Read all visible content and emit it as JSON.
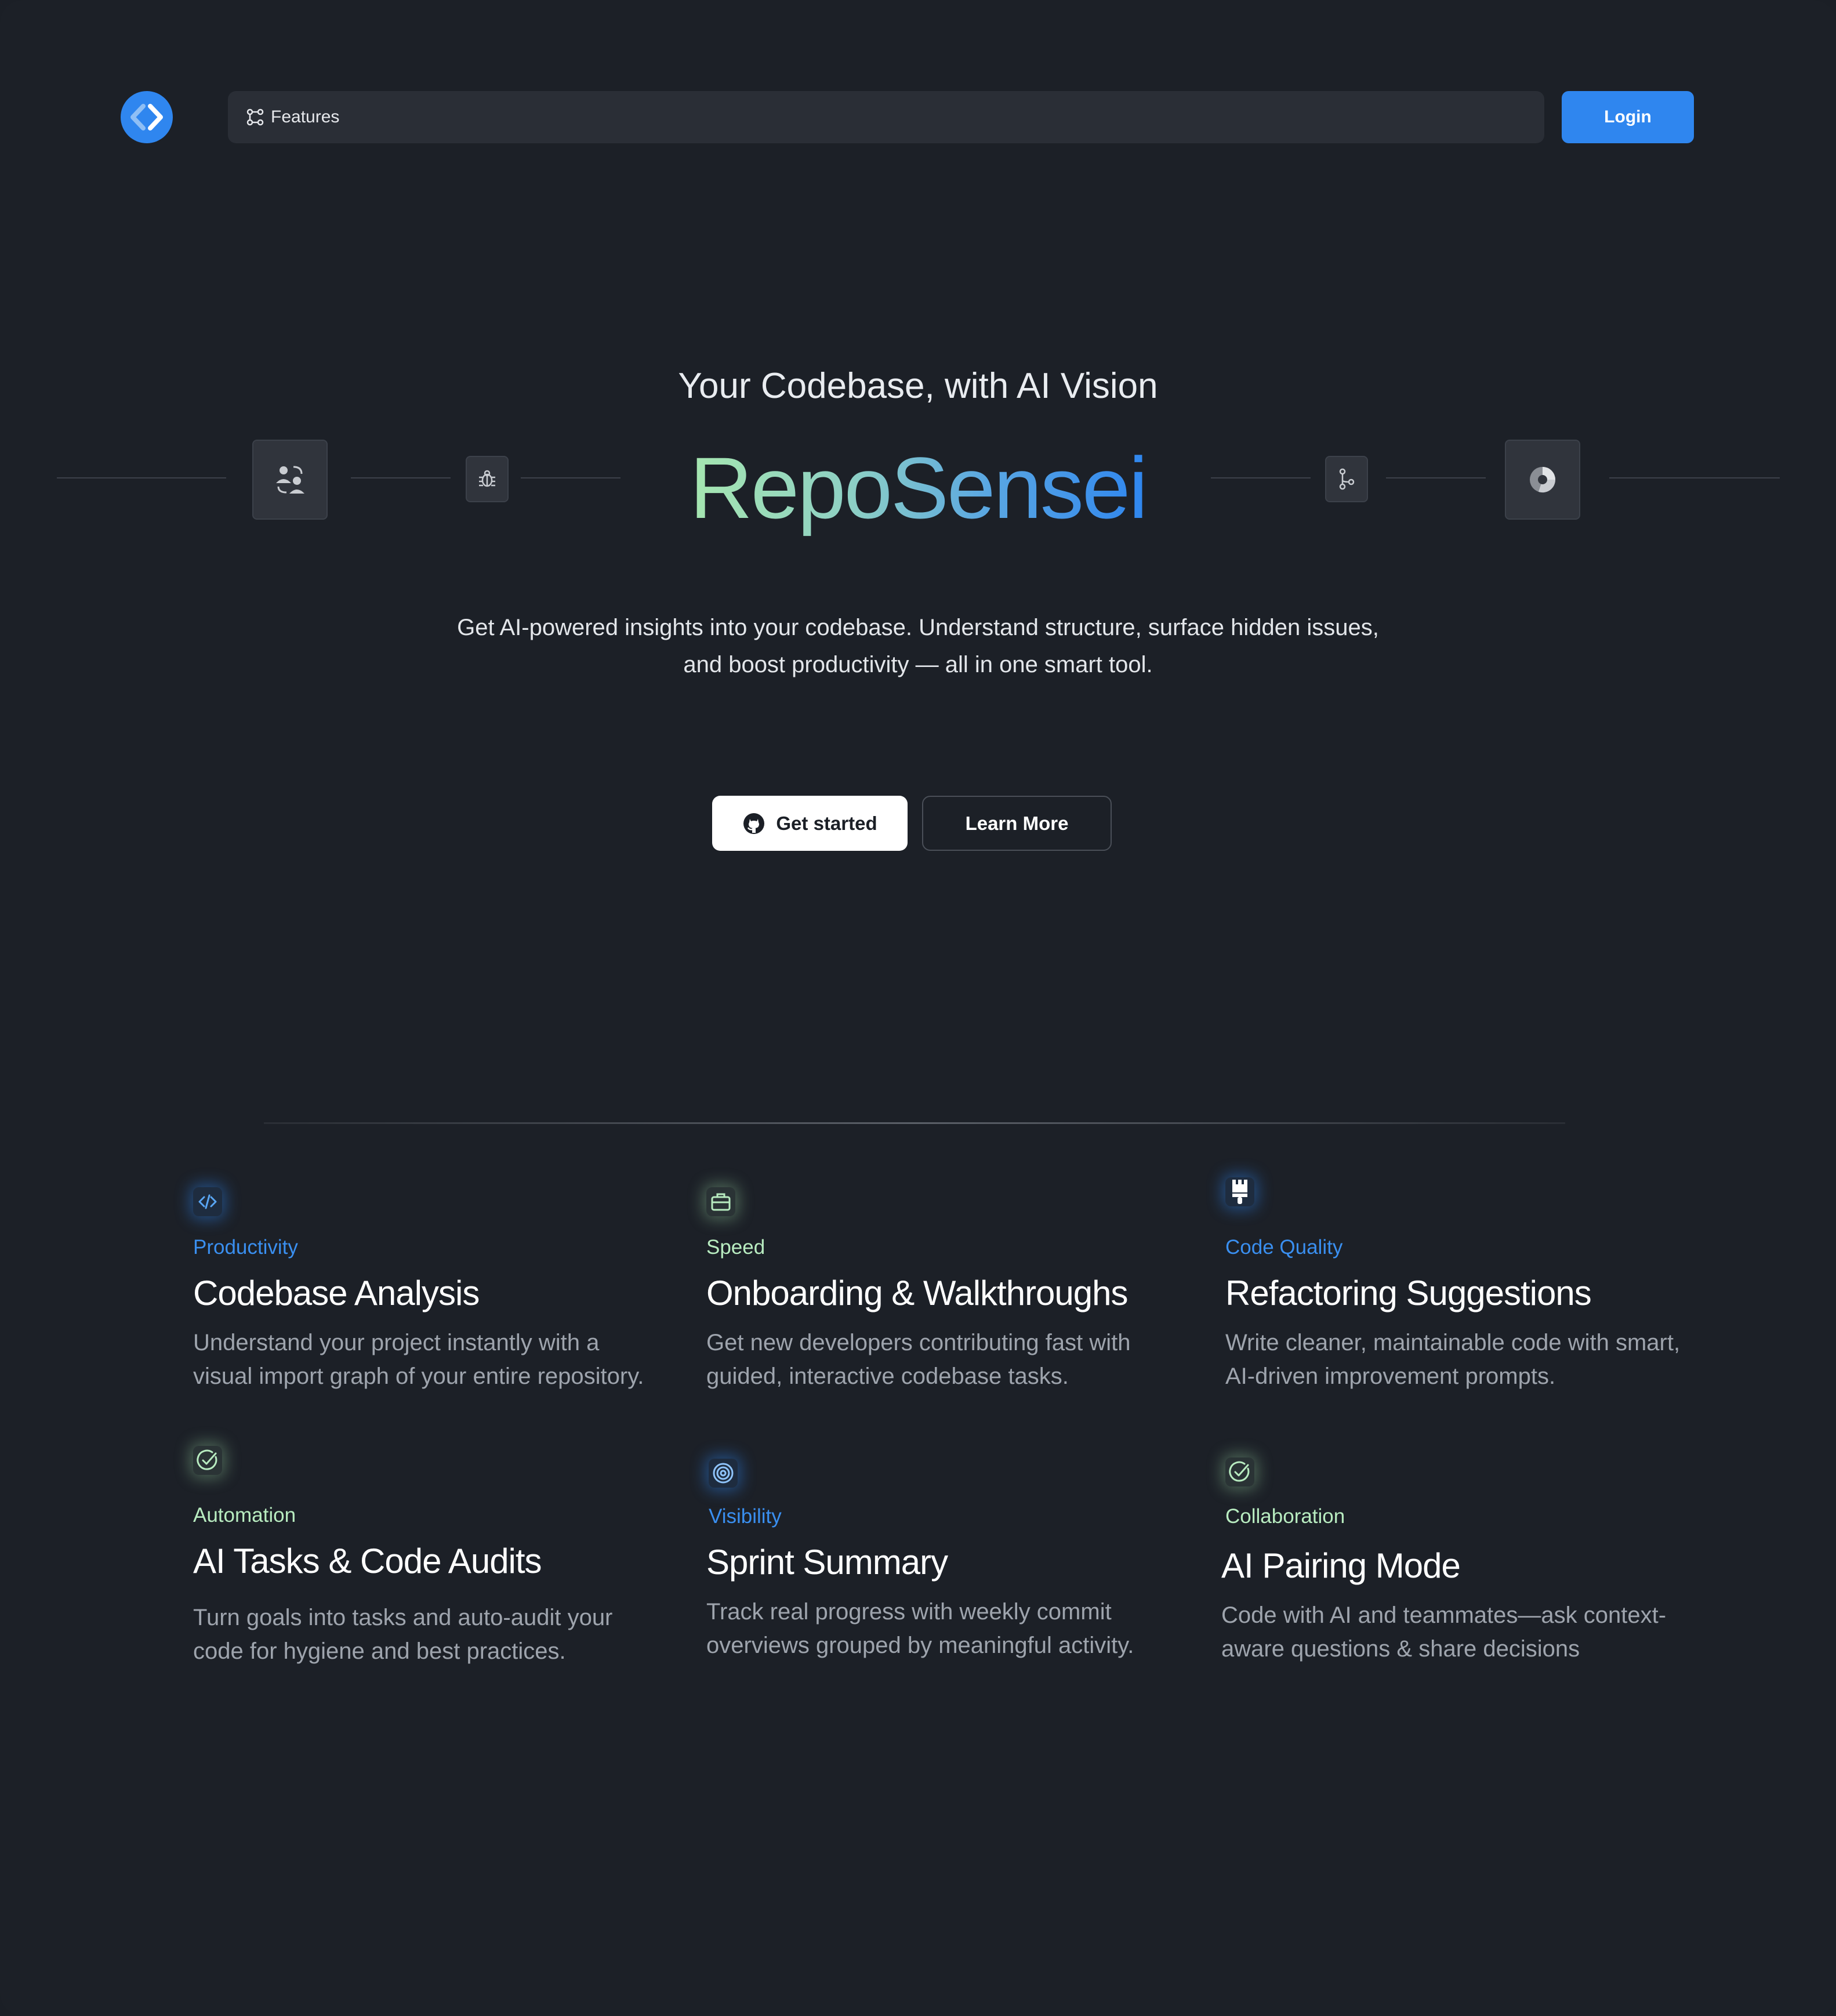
{
  "nav": {
    "items": [
      {
        "label": "Features",
        "icon": "graph-nodes-icon"
      }
    ],
    "login_label": "Login",
    "logo_icon": "code-chevron-logo-icon"
  },
  "hero": {
    "tagline": "Your Codebase, with AI Vision",
    "brand": "RepoSensei",
    "description": "Get AI-powered insights into your codebase. Understand structure, surface hidden issues, and boost productivity — all in one smart tool.",
    "cta_primary": "Get started",
    "cta_primary_icon": "github-icon",
    "cta_secondary": "Learn More",
    "icons": [
      "user-swap-icon",
      "bug-icon",
      "git-branch-icon",
      "pie-chart-icon"
    ]
  },
  "features": [
    {
      "category": "Productivity",
      "title": "Codebase Analysis",
      "description": "Understand your project instantly with a visual import graph of your entire repository.",
      "icon": "code-icon",
      "accent": "#3a8ff0"
    },
    {
      "category": "Speed",
      "title": "Onboarding & Walkthroughs",
      "description": "Get new developers contributing fast with guided, interactive codebase tasks.",
      "icon": "briefcase-icon",
      "accent": "#b8ecc0"
    },
    {
      "category": "Code Quality",
      "title": "Refactoring Suggestions",
      "description": "Write cleaner, maintainable code with smart, AI-driven improvement prompts.",
      "icon": "paint-brush-icon",
      "accent": "#3a8ff0"
    },
    {
      "category": "Automation",
      "title": "AI Tasks & Code Audits",
      "description": "Turn goals into tasks and auto-audit your code for hygiene and best practices.",
      "icon": "check-circle-icon",
      "accent": "#b8ecc0"
    },
    {
      "category": "Visibility",
      "title": "Sprint Summary",
      "description": "Track real progress with weekly commit overviews grouped by meaningful activity.",
      "icon": "target-icon",
      "accent": "#3a8ff0"
    },
    {
      "category": "Collaboration",
      "title": "AI Pairing Mode",
      "description": "Code with AI and teammates—ask context-aware questions & share decisions",
      "icon": "check-circle-icon",
      "accent": "#b8ecc0"
    }
  ]
}
